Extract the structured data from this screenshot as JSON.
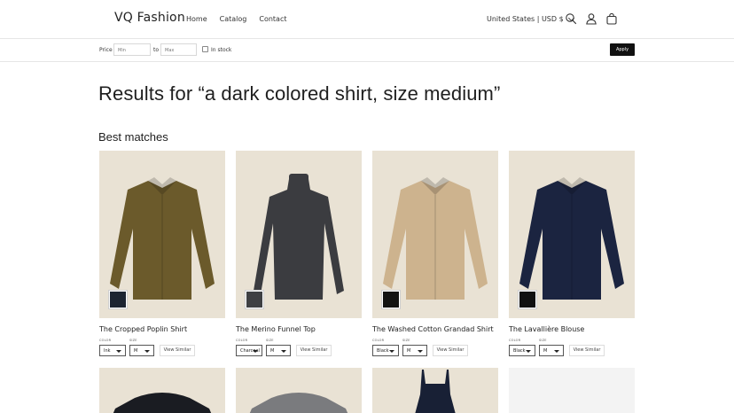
{
  "header": {
    "logo": "VQ Fashion",
    "nav": [
      "Home",
      "Catalog",
      "Contact"
    ],
    "country": "United States | USD $"
  },
  "filters": {
    "price_label": "Price",
    "min_placeholder": "Min",
    "to_label": "to",
    "max_placeholder": "Max",
    "in_stock_label": "In stock",
    "apply_label": "Apply"
  },
  "results_heading": "Results for “a dark colored shirt, size medium”",
  "section_heading": "Best matches",
  "products": [
    {
      "title": "The Cropped Poplin Shirt",
      "color_label": "COLOR",
      "size_label": "SIZE",
      "color": "Ink",
      "size": "M",
      "view_similar": "View Similar",
      "swatch": "#1c2431",
      "garment": "#6b5a2b",
      "bg": "#e9e2d4"
    },
    {
      "title": "The Merino Funnel Top",
      "color_label": "COLOR",
      "size_label": "SIZE",
      "color": "Charcoal",
      "size": "M",
      "view_similar": "View Similar",
      "swatch": "#3f4043",
      "garment": "#3b3c40",
      "bg": "#e9e2d4"
    },
    {
      "title": "The Washed Cotton Grandad Shirt",
      "color_label": "COLOR",
      "size_label": "SIZE",
      "color": "Black",
      "size": "M",
      "view_similar": "View Similar",
      "swatch": "#121212",
      "garment": "#cdb38e",
      "bg": "#e9e2d4"
    },
    {
      "title": "The Lavallière Blouse",
      "color_label": "COLOR",
      "size_label": "SIZE",
      "color": "Black",
      "size": "M",
      "view_similar": "View Similar",
      "swatch": "#101010",
      "garment": "#1b2440",
      "bg": "#e9e2d4"
    }
  ],
  "row2": [
    {
      "garment": "#1a1c22",
      "bg": "#e9e2d4"
    },
    {
      "garment": "#7a7b7e",
      "bg": "#e9e2d4"
    },
    {
      "garment": "#182035",
      "bg": "#e9e2d4"
    },
    {
      "garment": "#f3f3f3",
      "bg": "#f3f3f3"
    }
  ],
  "icons": [
    "search-icon",
    "account-icon",
    "cart-icon",
    "chevron-down-icon"
  ]
}
